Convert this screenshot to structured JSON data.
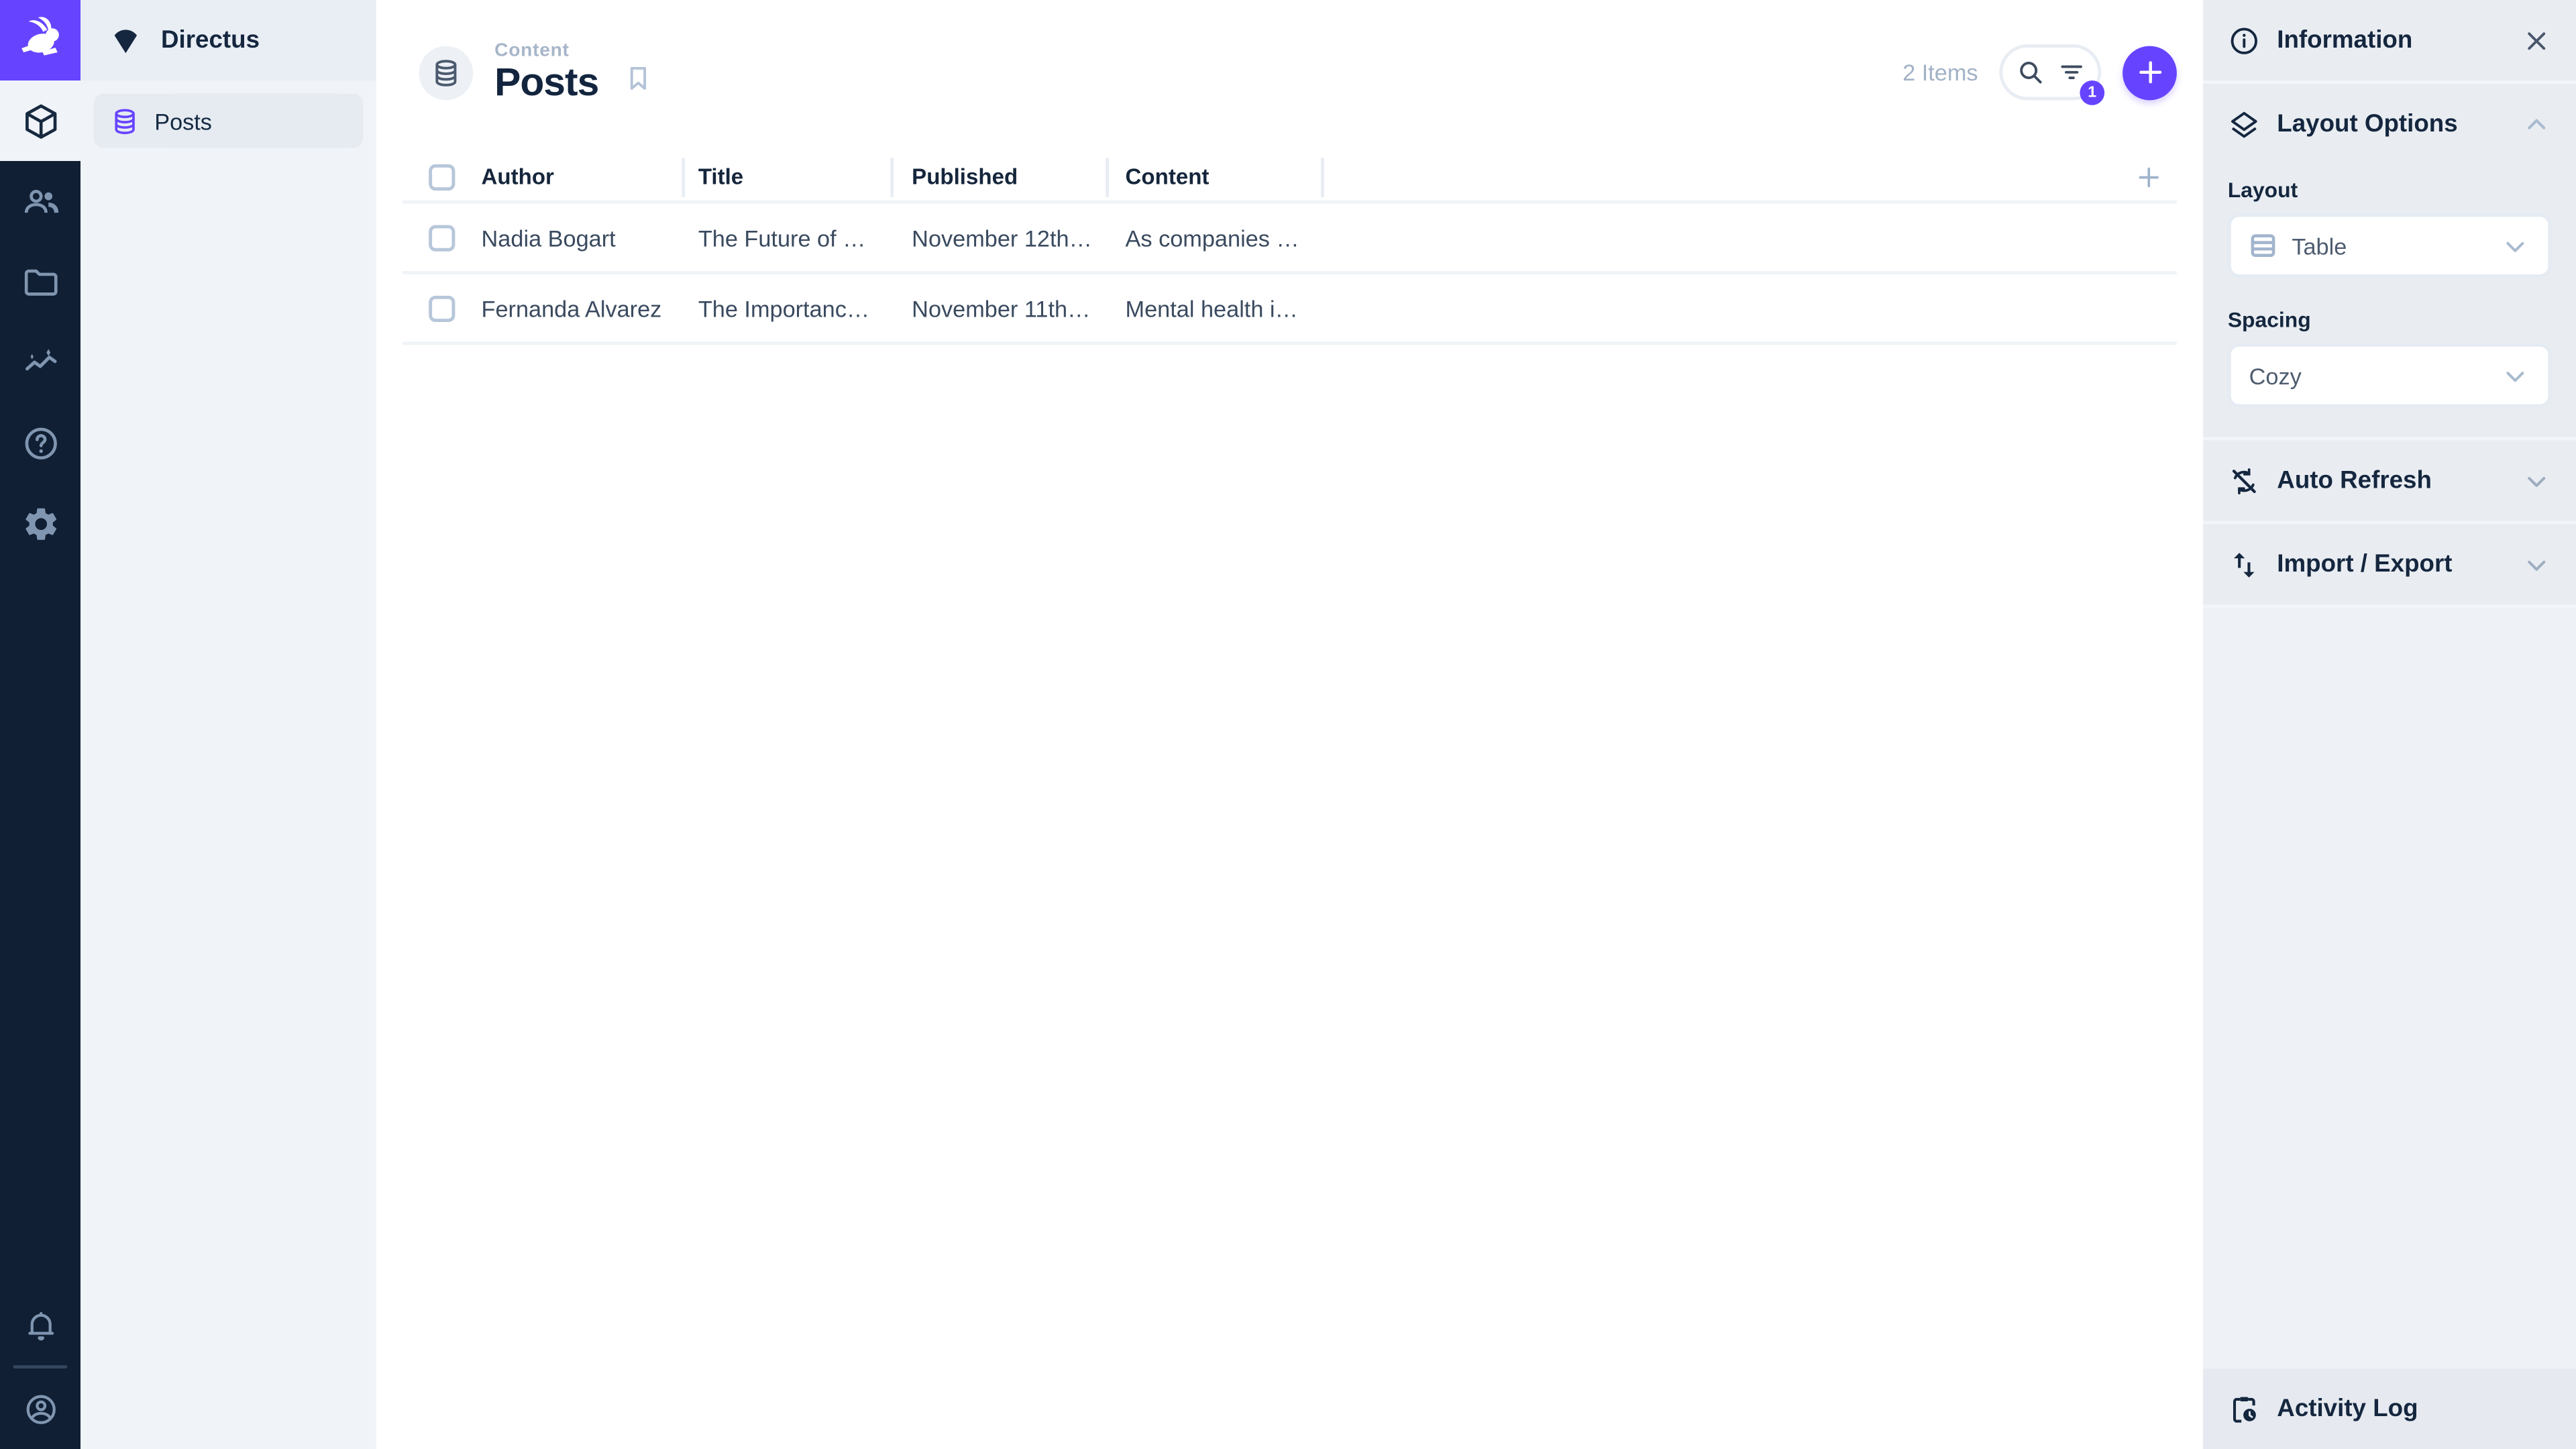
{
  "colors": {
    "accent": "#6644ff",
    "module_bar": "#101f33",
    "nav_bg": "#f0f4f9",
    "sidebar_bg": "#e9edf2",
    "title_text": "#13253e",
    "muted_text": "#a2b2c6"
  },
  "project": {
    "name": "Directus"
  },
  "nav": {
    "items": [
      {
        "label": "Posts"
      }
    ]
  },
  "modules": [
    "content",
    "users",
    "files",
    "insights",
    "help",
    "settings",
    "notifications",
    "account"
  ],
  "icons": {
    "logo": "directus-rabbit",
    "content": "cube",
    "users": "people",
    "files": "folder",
    "insights": "trend-sparkle",
    "help": "question-circle",
    "settings": "gear",
    "notifications": "bell",
    "account": "user-circle",
    "collection": "database-cylinder",
    "bookmark": "bookmark-outline",
    "search": "magnifier",
    "filter": "filter-lines",
    "add": "plus",
    "information": "info-circle",
    "close": "x",
    "layout_options": "layers",
    "auto_refresh": "sync-disabled",
    "import_export": "swap-vertical",
    "activity_log": "clipboard-clock",
    "layout_value": "table-rows",
    "chevron": "chevron"
  },
  "header": {
    "breadcrumb": "Content",
    "title": "Posts",
    "items_count": "2 Items",
    "filter_badge": "1"
  },
  "table": {
    "columns": [
      "Author",
      "Title",
      "Published",
      "Content"
    ],
    "rows": [
      [
        "Nadia Bogart",
        "The Future of Re...",
        "November 12th, ...",
        "As companies e..."
      ],
      [
        "Fernanda Alvarez",
        "The Importance ...",
        "November 11th, ...",
        "Mental health is j..."
      ]
    ]
  },
  "sidebar": {
    "information": "Information",
    "layout_options": "Layout Options",
    "layout_label": "Layout",
    "layout_value": "Table",
    "spacing_label": "Spacing",
    "spacing_value": "Cozy",
    "auto_refresh": "Auto Refresh",
    "import_export": "Import / Export",
    "activity_log": "Activity Log"
  }
}
